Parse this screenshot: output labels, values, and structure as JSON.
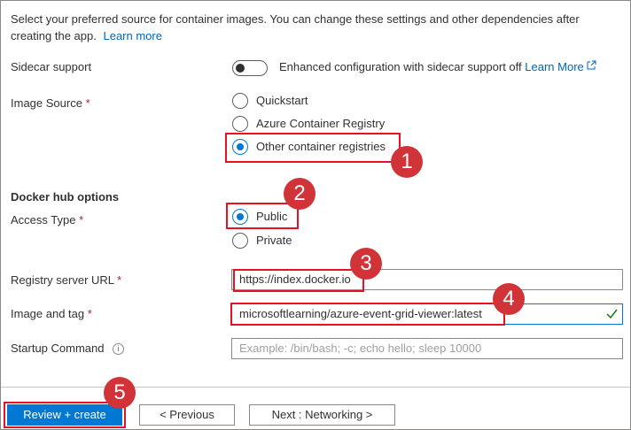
{
  "intro": {
    "text": "Select your preferred source for container images. You can change these settings and other dependencies after creating the app.",
    "learn_more": "Learn more"
  },
  "sidecar": {
    "label": "Sidecar support",
    "toggle_state": "off",
    "description": "Enhanced configuration with sidecar support off",
    "learn_more": "Learn More",
    "external_icon": "external-link-icon"
  },
  "image_source": {
    "label": "Image Source",
    "required": "*",
    "options": [
      "Quickstart",
      "Azure Container Registry",
      "Other container registries"
    ],
    "selected": "Other container registries"
  },
  "docker_hub": {
    "heading": "Docker hub options",
    "access_type": {
      "label": "Access Type",
      "required": "*",
      "options": [
        "Public",
        "Private"
      ],
      "selected": "Public"
    },
    "registry_url": {
      "label": "Registry server URL",
      "required": "*",
      "value": "https://index.docker.io"
    },
    "image_tag": {
      "label": "Image and tag",
      "required": "*",
      "value": "microsoftlearning/azure-event-grid-viewer:latest",
      "valid_icon": "checkmark-icon"
    },
    "startup_command": {
      "label": "Startup Command",
      "info_icon": "i",
      "placeholder": "Example: /bin/bash; -c; echo hello; sleep 10000"
    }
  },
  "callouts": [
    "1",
    "2",
    "3",
    "4",
    "5"
  ],
  "footer": {
    "review_create": "Review + create",
    "previous": "< Previous",
    "next": "Next : Networking >"
  },
  "colors": {
    "accent": "#0078d4",
    "link": "#0067b8",
    "callout": "#d13438",
    "highlight": "#e81123",
    "valid": "#107c10"
  }
}
